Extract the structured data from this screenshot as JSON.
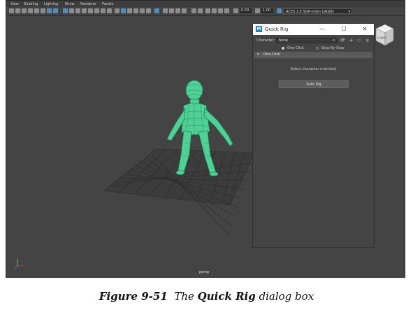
{
  "menubar": [
    "View",
    "Shading",
    "Lighting",
    "Show",
    "Renderer",
    "Panels"
  ],
  "toolbar": {
    "field_1": "0.00",
    "field_2": "1.00",
    "color_space": "ACES 1.0 SDR-video (sRGB)"
  },
  "viewport": {
    "camera_label": "persp",
    "view_cube_label": "FRONT"
  },
  "dialog": {
    "title": "Quick Rig",
    "minimize": "—",
    "maximize": "☐",
    "close": "✕",
    "character_label": "Character:",
    "character_value": "None",
    "mode_one_click": "One-Click",
    "mode_step_by_step": "Step-By-Step",
    "section_label": "One-Click",
    "hint": "Select character mesh(es)",
    "auto_rig_button": "Auto Rig"
  },
  "caption": {
    "figure": "Figure 9-51",
    "the": "The",
    "bold_term": "Quick Rig",
    "rest": "dialog box"
  },
  "colors": {
    "viewport_bg": "#444444",
    "mesh_green": "#4fd196",
    "logo_blue": "#1d7dc5"
  }
}
